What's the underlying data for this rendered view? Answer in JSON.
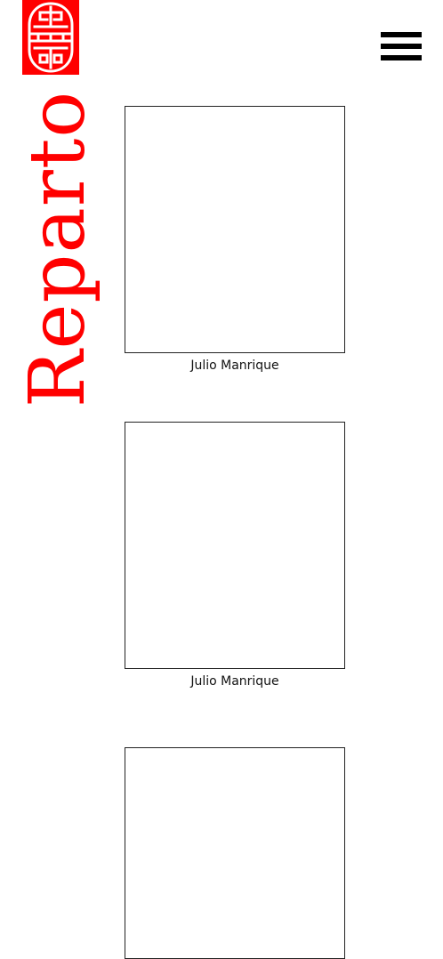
{
  "header": {
    "logo_icon": "chinese-shou-symbol-icon",
    "menu_icon": "hamburger-menu-icon",
    "brand_color": "#ff0000"
  },
  "section": {
    "title": "Reparto"
  },
  "cast": [
    {
      "name": "Julio Manrique"
    },
    {
      "name": "Julio Manrique"
    },
    {
      "name": ""
    }
  ]
}
